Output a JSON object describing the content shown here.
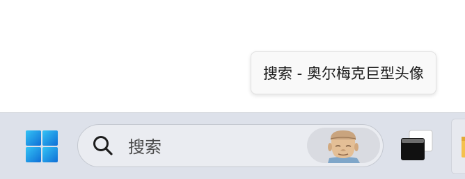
{
  "tooltip": {
    "text": "搜索 - 奥尔梅克巨型头像"
  },
  "taskbar": {
    "start_icon": "windows-logo-icon",
    "search": {
      "placeholder": "搜索",
      "icon": "search-icon",
      "highlight_image": "olmec-colossal-head-icon"
    },
    "task_view_icon": "task-view-icon",
    "file_explorer_icon": "folder-icon"
  },
  "colors": {
    "taskbar_bg": "#dde1ea",
    "search_bg": "#eaecf1",
    "windows_blue": "#1f8fe6",
    "tooltip_bg": "#f9f9f9"
  }
}
